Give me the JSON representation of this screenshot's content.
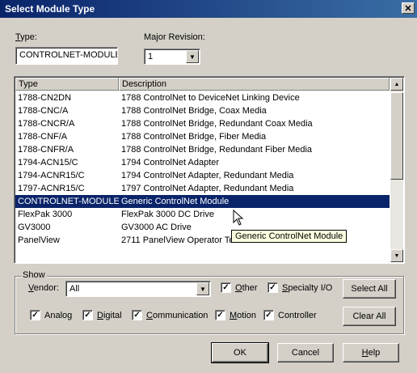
{
  "window": {
    "title": "Select Module Type",
    "close_glyph": "✕"
  },
  "type_field": {
    "label": "Type:",
    "value": "CONTROLNET-MODULE"
  },
  "revision": {
    "label": "Major Revision:",
    "value": "1"
  },
  "list": {
    "columns": [
      "Type",
      "Description"
    ],
    "rows": [
      {
        "type": "1788-CN2DN",
        "description": "1788 ControlNet to DeviceNet Linking Device"
      },
      {
        "type": "1788-CNC/A",
        "description": "1788 ControlNet Bridge, Coax Media"
      },
      {
        "type": "1788-CNCR/A",
        "description": "1788 ControlNet Bridge, Redundant Coax Media"
      },
      {
        "type": "1788-CNF/A",
        "description": "1788 ControlNet Bridge, Fiber Media"
      },
      {
        "type": "1788-CNFR/A",
        "description": "1788 ControlNet Bridge, Redundant Fiber Media"
      },
      {
        "type": "1794-ACN15/C",
        "description": "1794 ControlNet Adapter"
      },
      {
        "type": "1794-ACNR15/C",
        "description": "1794 ControlNet Adapter, Redundant Media"
      },
      {
        "type": "1797-ACNR15/C",
        "description": "1797 ControlNet Adapter, Redundant Media"
      },
      {
        "type": "CONTROLNET-MODULE",
        "description": "Generic ControlNet Module",
        "selected": true
      },
      {
        "type": "FlexPak 3000",
        "description": "FlexPak 3000 DC Drive"
      },
      {
        "type": "GV3000",
        "description": "GV3000 AC Drive"
      },
      {
        "type": "PanelView",
        "description": "2711 PanelView Operator Terminal"
      }
    ],
    "tooltip": "Generic ControlNet Module"
  },
  "show": {
    "group_label": "Show",
    "vendor_label": "Vendor:",
    "vendor_value": "All",
    "checks": {
      "other": {
        "label": "Other",
        "checked": true
      },
      "specialty": {
        "label": "Specialty I/O",
        "checked": true
      },
      "analog": {
        "label": "Analog",
        "checked": true
      },
      "digital": {
        "label": "Digital",
        "checked": true
      },
      "communication": {
        "label": "Communication",
        "checked": true
      },
      "motion": {
        "label": "Motion",
        "checked": true
      },
      "controller": {
        "label": "Controller",
        "checked": true
      }
    },
    "select_all": "Select All",
    "clear_all": "Clear All"
  },
  "buttons": {
    "ok": "OK",
    "cancel": "Cancel",
    "help": "Help"
  },
  "icons": {
    "dropdown": "chevron-down-icon",
    "check": "checkmark-icon",
    "scroll_up": "scroll-up-arrow-icon",
    "scroll_down": "scroll-down-arrow-icon",
    "cursor": "mouse-pointer-icon"
  },
  "colors": {
    "title_bar": "#0a246a",
    "selection": "#0a246a",
    "face": "#d4d0c8",
    "tooltip": "#ffffe1"
  }
}
